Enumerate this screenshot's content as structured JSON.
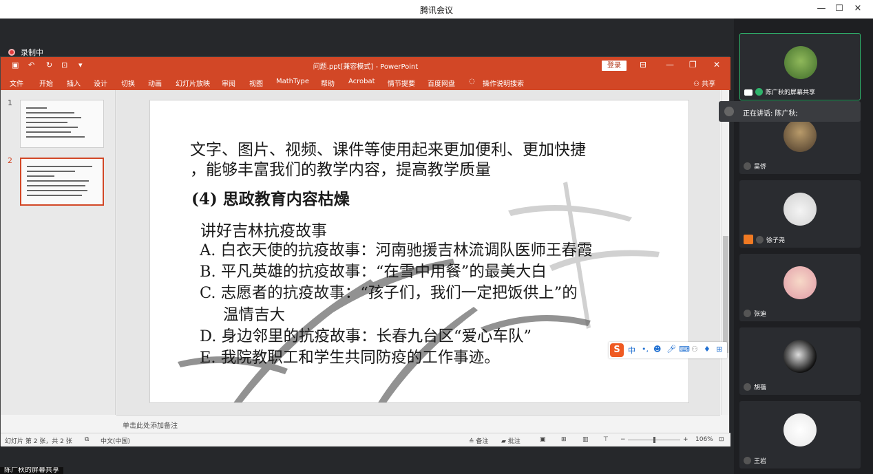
{
  "window": {
    "title": "腾讯会议",
    "minimize": "—",
    "maximize": "☐",
    "close": "✕"
  },
  "recording": {
    "label": "录制中"
  },
  "powerpoint": {
    "title": "问题.ppt[兼容模式]  -  PowerPoint",
    "login": "登录",
    "share": "共享",
    "tabs": [
      "文件",
      "开始",
      "插入",
      "设计",
      "切换",
      "动画",
      "幻灯片放映",
      "审阅",
      "视图",
      "MathType",
      "帮助",
      "Acrobat",
      "情节提要",
      "百度网盘",
      "操作说明搜索"
    ],
    "slide_numbers": [
      "1",
      "2"
    ],
    "notes_placeholder": "单击此处添加备注",
    "status": {
      "slide_info": "幻灯片 第 2 张，共 2 张",
      "language": "中文(中国)",
      "notes_btn": "备注",
      "comments_btn": "批注",
      "zoom": "106%"
    }
  },
  "slide": {
    "line1": "文字、图片、视频、课件等使用起来更加便利、更加快捷",
    "line2": "，能够丰富我们的教学内容，提高教学质量",
    "heading": "(4) 思政教育内容枯燥",
    "sub": "讲好吉林抗疫故事",
    "items": [
      "A. 白衣天使的抗疫故事：河南驰援吉林流调队医师王春霞",
      "B. 平凡英雄的抗疫故事：“在雪中用餐”的最美大白",
      "C. 志愿者的抗疫故事：“孩子们，我们一定把饭供上”的",
      "温情吉大",
      "D. 身边邻里的抗疫故事：长春九台区“爱心车队”",
      "E.  我院教职工和学生共同防疫的工作事迹。"
    ]
  },
  "ime": {
    "logo": "S",
    "lang": "中"
  },
  "panel": {
    "speaking_label": "正在讲话: 陈广秋;",
    "participants": [
      {
        "name": "陈广秋的屏幕共享"
      },
      {
        "name": "吴侨"
      },
      {
        "name": "徐子尧"
      },
      {
        "name": "张迪"
      },
      {
        "name": "胡蓓"
      },
      {
        "name": "王岩"
      }
    ]
  },
  "bottom_label": "陈广秋的屏幕共享"
}
